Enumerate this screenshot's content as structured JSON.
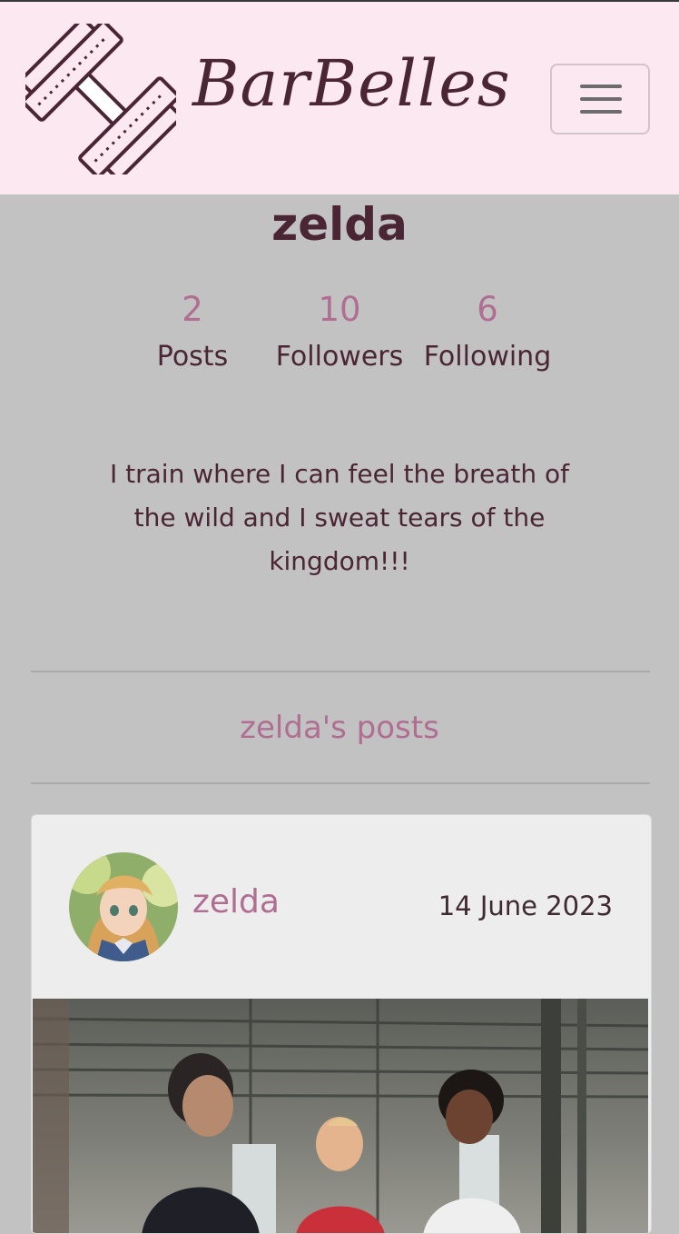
{
  "navbar": {
    "brand": "BarBelles",
    "logo_icon": "dumbbell-icon",
    "menu_icon": "hamburger-menu-icon"
  },
  "profile": {
    "name": "zelda",
    "stats": [
      {
        "value": "2",
        "label": "Posts"
      },
      {
        "value": "10",
        "label": "Followers"
      },
      {
        "value": "6",
        "label": "Following"
      }
    ],
    "bio": "I train where I can feel the breath of the wild and I sweat tears of the kingdom!!!"
  },
  "posts_section": {
    "title": "zelda's posts"
  },
  "post": {
    "author": "zelda",
    "date": "14 June 2023"
  },
  "colors": {
    "navbar_bg": "#fbe8f1",
    "page_bg": "#c2c2c2",
    "accent": "#b06e93",
    "text": "#4a2634"
  }
}
